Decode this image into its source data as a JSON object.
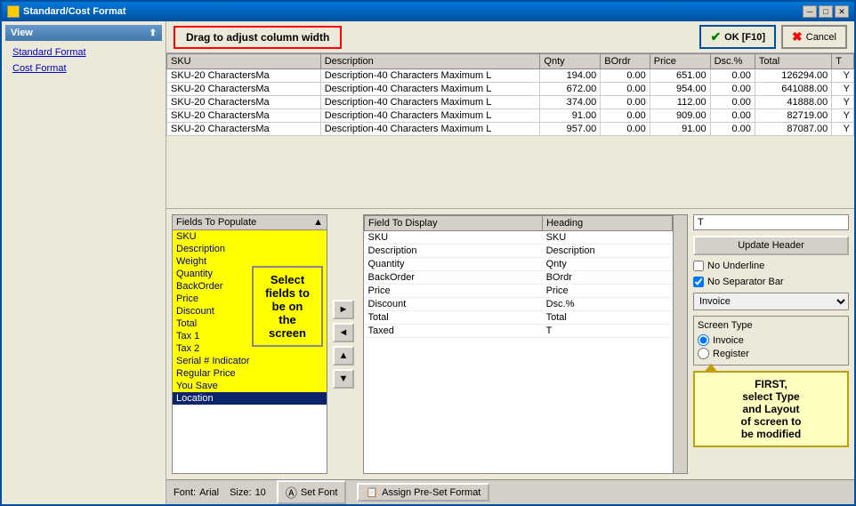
{
  "window": {
    "title": "Standard/Cost Format"
  },
  "title_buttons": {
    "minimize": "─",
    "maximize": "□",
    "close": "✕"
  },
  "top_bar": {
    "drag_hint": "Drag to adjust column width",
    "ok_label": "OK [F10]",
    "cancel_label": "Cancel"
  },
  "sidebar": {
    "header": "View",
    "items": [
      {
        "label": "Standard Format",
        "id": "standard-format"
      },
      {
        "label": "Cost Format",
        "id": "cost-format"
      }
    ]
  },
  "table": {
    "columns": [
      "SKU",
      "Description",
      "Qnty",
      "BOrdr",
      "Price",
      "Dsc.%",
      "Total",
      "T"
    ],
    "rows": [
      [
        "SKU-20 CharactersMa",
        "Description-40 Characters Maximum L",
        "194.00",
        "0.00",
        "651.00",
        "0.00",
        "126294.00",
        "Y"
      ],
      [
        "SKU-20 CharactersMa",
        "Description-40 Characters Maximum L",
        "672.00",
        "0.00",
        "954.00",
        "0.00",
        "641088.00",
        "Y"
      ],
      [
        "SKU-20 CharactersMa",
        "Description-40 Characters Maximum L",
        "374.00",
        "0.00",
        "112.00",
        "0.00",
        "41888.00",
        "Y"
      ],
      [
        "SKU-20 CharactersMa",
        "Description-40 Characters Maximum L",
        "91.00",
        "0.00",
        "909.00",
        "0.00",
        "82719.00",
        "Y"
      ],
      [
        "SKU-20 CharactersMa",
        "Description-40 Characters Maximum L",
        "957.00",
        "0.00",
        "91.00",
        "0.00",
        "87087.00",
        "Y"
      ]
    ]
  },
  "fields_to_populate": {
    "header": "Fields To Populate",
    "items": [
      "SKU",
      "Description",
      "Weight",
      "Quantity",
      "BackOrder",
      "Price",
      "Discount",
      "Total",
      "Tax 1",
      "Tax 2",
      "Serial # Indicator",
      "Regular Price",
      "You Save",
      "Location"
    ],
    "selected": "Location",
    "hint": "Select\nfields to\nbe on\nthe\nscreen"
  },
  "arrow_buttons": {
    "right": "►",
    "left": "◄",
    "up": "▲",
    "down": "▼"
  },
  "field_to_display": {
    "col1": "Field To Display",
    "col2": "Heading",
    "rows": [
      [
        "SKU",
        "SKU"
      ],
      [
        "Description",
        "Description"
      ],
      [
        "Quantity",
        "Qnty"
      ],
      [
        "BackOrder",
        "BOrdr"
      ],
      [
        "Price",
        "Price"
      ],
      [
        "Discount",
        "Dsc.%"
      ],
      [
        "Total",
        "Total"
      ],
      [
        "Taxed",
        "T"
      ]
    ]
  },
  "right_config": {
    "heading_value": "T",
    "update_header_label": "Update Header",
    "no_underline_label": "No Underline",
    "no_separator_label": "No Separator Bar",
    "no_underline_checked": false,
    "no_separator_checked": true,
    "dropdown_value": "Invoice",
    "dropdown_options": [
      "Invoice",
      "Register"
    ],
    "screen_type_label": "Screen Type",
    "invoice_label": "Invoice",
    "register_label": "Register",
    "invoice_selected": true,
    "tooltip": "FIRST,\nselect Type\nand Layout\nof screen to\nbe modified"
  },
  "status_bar": {
    "font_label": "Font:",
    "font_value": "Arial",
    "size_label": "Size:",
    "size_value": "10",
    "set_font_label": "Set Font",
    "assign_format_label": "Assign Pre-Set Format"
  }
}
